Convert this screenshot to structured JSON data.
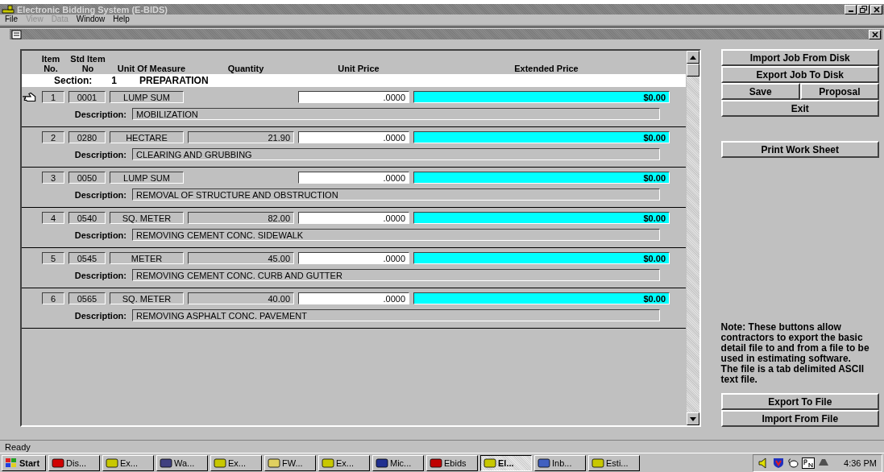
{
  "window": {
    "title": "Electronic Bidding System (E-BIDS)"
  },
  "menu": [
    {
      "label": "File",
      "disabled": false
    },
    {
      "label": "View",
      "disabled": true
    },
    {
      "label": "Data",
      "disabled": true
    },
    {
      "label": "Window",
      "disabled": false
    },
    {
      "label": "Help",
      "disabled": false
    }
  ],
  "grid": {
    "columns": [
      "Item No.",
      "Std Item No",
      "Unit Of Measure",
      "Quantity",
      "Unit Price",
      "Extended Price"
    ],
    "section_label": "Section:",
    "section_number": "1",
    "section_name": "PREPARATION",
    "rows": [
      {
        "item": "1",
        "std_item": "0001",
        "unit": "LUMP SUM",
        "unit_price": ".0000",
        "extended": "$0.00",
        "description_label": "Description:",
        "description": "MOBILIZATION",
        "current": true
      },
      {
        "item": "2",
        "std_item": "0280",
        "unit": "HECTARE",
        "quantity": "21.90",
        "unit_price": ".0000",
        "extended": "$0.00",
        "description_label": "Description:",
        "description": "CLEARING AND GRUBBING",
        "current": false
      },
      {
        "item": "3",
        "std_item": "0050",
        "unit": "LUMP SUM",
        "unit_price": ".0000",
        "extended": "$0.00",
        "description_label": "Description:",
        "description": "REMOVAL OF STRUCTURE AND OBSTRUCTION",
        "current": false
      },
      {
        "item": "4",
        "std_item": "0540",
        "unit": "SQ. METER",
        "quantity": "82.00",
        "unit_price": ".0000",
        "extended": "$0.00",
        "description_label": "Description:",
        "description": "REMOVING CEMENT CONC. SIDEWALK",
        "current": false
      },
      {
        "item": "5",
        "std_item": "0545",
        "unit": "METER",
        "quantity": "45.00",
        "unit_price": ".0000",
        "extended": "$0.00",
        "description_label": "Description:",
        "description": "REMOVING CEMENT CONC. CURB AND GUTTER",
        "current": false
      },
      {
        "item": "6",
        "std_item": "0565",
        "unit": "SQ. METER",
        "quantity": "40.00",
        "unit_price": ".0000",
        "extended": "$0.00",
        "description_label": "Description:",
        "description": "REMOVING ASPHALT CONC. PAVEMENT",
        "current": false
      }
    ]
  },
  "side": {
    "import_job": "Import Job From Disk",
    "export_job": "Export Job To Disk",
    "save": "Save",
    "proposal": "Proposal",
    "exit": "Exit",
    "print": "Print Work Sheet",
    "note": "Note:  These buttons allow contractors to export the basic detail file to and from a file to be used in estimating software. The file is a tab delimited ASCII text file.",
    "export_file": "Export To File",
    "import_file": "Import From File"
  },
  "status_bar": "Ready",
  "taskbar": {
    "start": "Start",
    "clock": "4:36 PM",
    "items": [
      {
        "label": "Dis...",
        "selected": false
      },
      {
        "label": "Ex...",
        "selected": false
      },
      {
        "label": "Wa...",
        "selected": false
      },
      {
        "label": "Ex...",
        "selected": false
      },
      {
        "label": "FW...",
        "selected": false
      },
      {
        "label": "Ex...",
        "selected": false
      },
      {
        "label": "Mic...",
        "selected": false
      },
      {
        "label": "Ebids",
        "selected": false
      },
      {
        "label": "El...",
        "selected": true
      },
      {
        "label": "Inb...",
        "selected": false
      },
      {
        "label": "Esti...",
        "selected": false
      }
    ]
  }
}
